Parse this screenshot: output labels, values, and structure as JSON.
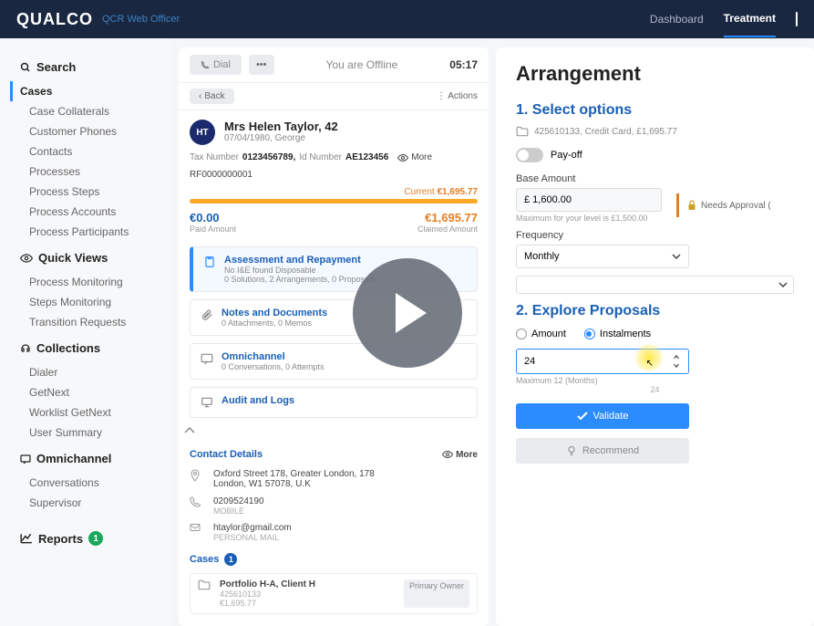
{
  "brand": "QUALCO",
  "app_subtitle": "QCR Web Officer",
  "topnav": {
    "dashboard": "Dashboard",
    "treatment": "Treatment"
  },
  "sidebar": {
    "search_head": "Search",
    "search_items": [
      "Cases",
      "Case Collaterals",
      "Customer Phones",
      "Contacts",
      "Processes",
      "Process Steps",
      "Process Accounts",
      "Process Participants"
    ],
    "quick_head": "Quick Views",
    "quick_items": [
      "Process Monitoring",
      "Steps Monitoring",
      "Transition Requests"
    ],
    "collections_head": "Collections",
    "collections_items": [
      "Dialer",
      "GetNext",
      "Worklist GetNext",
      "User Summary"
    ],
    "omni_head": "Omnichannel",
    "omni_items": [
      "Conversations",
      "Supervisor"
    ],
    "reports_label": "Reports",
    "reports_badge": "1"
  },
  "mid": {
    "dial": "Dial",
    "offline": "You are Offline",
    "clock": "05:17",
    "back": "Back",
    "actions": "Actions",
    "avatar": "HT",
    "name": "Mrs Helen Taylor, 42",
    "dob": "07/04/1980, George",
    "taxlbl": "Tax Number",
    "taxval": "0123456789,",
    "idlbl": "Id Number",
    "idval": "AE123456",
    "more": "More",
    "ref": "RF0000000001",
    "current_label": "Current",
    "current_val": "€1,695.77",
    "paid_amt": "€0.00",
    "paid_lbl": "Paid Amount",
    "claim_amt": "€1,695.77",
    "claim_lbl": "Claimed Amount",
    "sect1_t": "Assessment and Repayment",
    "sect1_s1": "No I&E found Disposable",
    "sect1_s2": "0 Solutions, 2 Arrangements, 0 Proposals",
    "sect2_t": "Notes and Documents",
    "sect2_s": "0 Attachments, 0 Memos",
    "sect3_t": "Omnichannel",
    "sect3_s": "0 Conversations, 0 Attempts",
    "sect4_t": "Audit and Logs",
    "contact_head": "Contact Details",
    "addr1": "Oxford Street 178, Greater London, 178",
    "addr2": "London, W1 57078, U.K",
    "phone": "0209524190",
    "phone_lbl": "MOBILE",
    "email": "htaylor@gmail.com",
    "email_lbl": "PERSONAL MAIL",
    "cases_head": "Cases",
    "cases_badge": "1",
    "case_title": "Portfolio H-A, Client H",
    "case_id": "425610133",
    "case_amt": "€1,695.77",
    "case_tag": "Primary Owner"
  },
  "right": {
    "title": "Arrangement",
    "step1": "1. Select options",
    "crumb": "425610133, Credit Card, £1,695.77",
    "payoff": "Pay-off",
    "base_lbl": "Base Amount",
    "base_val": "£ 1,600.00",
    "base_hint": "Maximum for your level is £1,500.00",
    "approval": "Needs Approval (",
    "freq_lbl": "Frequency",
    "freq_val": "Monthly",
    "step2": "2. Explore Proposals",
    "radio_amount": "Amount",
    "radio_inst": "Instalments",
    "inst_val": "24",
    "inst_hint": "Maximum 12 (Months)",
    "inst_hint_v": "24",
    "validate": "Validate",
    "recommend": "Recommend"
  }
}
